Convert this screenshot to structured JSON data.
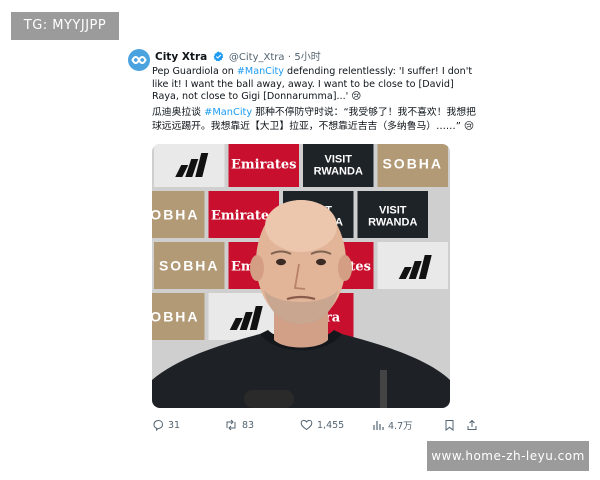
{
  "watermark": {
    "top_left": "TG: MYYJJPP",
    "bottom_right": "www.home-zh-leyu.com"
  },
  "tweet": {
    "display_name": "City Xtra",
    "handle": "@City_Xtra",
    "separator": "·",
    "time": "5小时",
    "text_en": {
      "before": "Pep Guardiola on ",
      "hashtag": "#ManCity",
      "after": " defending relentlessly: 'I suffer! I don't like it! I want the ball away, away. I want to be close to [David] Raya, not close to Gigi [Donnarumma]...' 😢"
    },
    "text_zh": {
      "before": "瓜迪奥拉谈 ",
      "hashtag": "#ManCity",
      "after": " 那种不停防守时说：“我受够了！我不喜欢！我想把球远远踢开。我想靠近【大卫】拉亚，不想靠近吉吉（多纳鲁马）……” 😢"
    },
    "actions": {
      "replies": "31",
      "reposts": "83",
      "likes": "1,455",
      "views": "4.7万"
    },
    "backdrop": {
      "sponsors": [
        "adidas",
        "Emirates",
        "VISIT RWANDA",
        "SOBHA",
        "SOBHA",
        "Emirates",
        "VISIT RWANDA",
        "VISIT RWANDA",
        "SOBHA",
        "Emirates",
        "Emirates",
        "adidas",
        "SOBHA",
        "adidas",
        "Emira"
      ]
    }
  },
  "colors": {
    "accent": "#1d9bf0",
    "emirates_red": "#c8102e",
    "rwanda_dark": "#1e2327",
    "sobha_tan": "#b39a76",
    "muted": "#536471"
  },
  "icons": [
    "city-xtra-logo-icon",
    "verified-badge-icon",
    "reply-icon",
    "repost-icon",
    "like-icon",
    "views-icon",
    "bookmark-icon",
    "share-icon"
  ]
}
